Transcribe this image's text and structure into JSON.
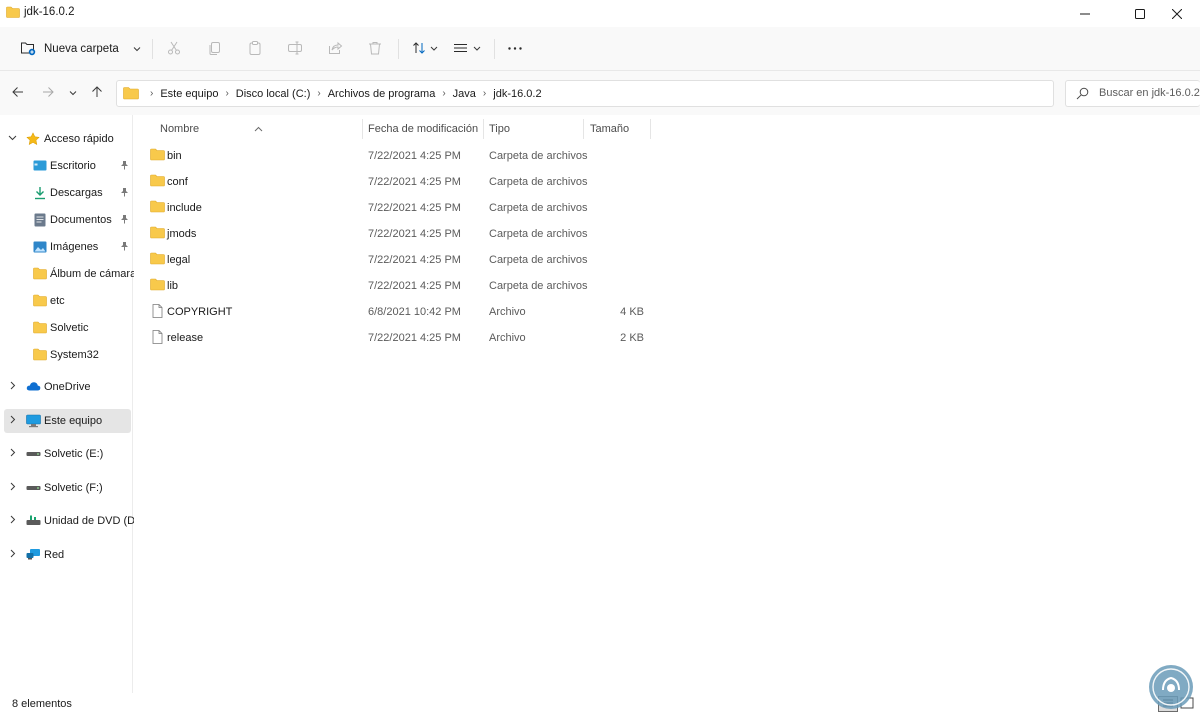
{
  "window": {
    "title": "jdk-16.0.2"
  },
  "command_bar": {
    "new_folder_label": "Nueva carpeta"
  },
  "address": {
    "crumbs": [
      "Este equipo",
      "Disco local (C:)",
      "Archivos de programa",
      "Java",
      "jdk-16.0.2"
    ],
    "search_placeholder": "Buscar en jdk-16.0.2"
  },
  "sidebar": {
    "quick_access": "Acceso rápido",
    "pinned": [
      {
        "label": "Escritorio",
        "icon": "desktop-icon",
        "pinned": true
      },
      {
        "label": "Descargas",
        "icon": "download-icon",
        "pinned": true
      },
      {
        "label": "Documentos",
        "icon": "document-icon",
        "pinned": true
      },
      {
        "label": "Imágenes",
        "icon": "image-icon",
        "pinned": true
      },
      {
        "label": "Álbum de cámara",
        "icon": "folder-icon",
        "pinned": false
      },
      {
        "label": "etc",
        "icon": "folder-icon",
        "pinned": false
      },
      {
        "label": "Solvetic",
        "icon": "folder-icon",
        "pinned": false
      },
      {
        "label": "System32",
        "icon": "folder-icon",
        "pinned": false
      }
    ],
    "roots": [
      {
        "label": "OneDrive",
        "icon": "cloud-icon"
      },
      {
        "label": "Este equipo",
        "icon": "computer-icon",
        "selected": true
      },
      {
        "label": "Solvetic (E:)",
        "icon": "drive-icon"
      },
      {
        "label": "Solvetic (F:)",
        "icon": "drive-icon"
      },
      {
        "label": "Unidad de DVD (D:)",
        "icon": "dvd-icon"
      },
      {
        "label": "Red",
        "icon": "network-icon"
      }
    ]
  },
  "columns": {
    "name": "Nombre",
    "date": "Fecha de modificación",
    "type": "Tipo",
    "size": "Tamaño"
  },
  "files": [
    {
      "name": "bin",
      "date": "7/22/2021 4:25 PM",
      "type": "Carpeta de archivos",
      "size": "",
      "icon": "folder-icon"
    },
    {
      "name": "conf",
      "date": "7/22/2021 4:25 PM",
      "type": "Carpeta de archivos",
      "size": "",
      "icon": "folder-icon"
    },
    {
      "name": "include",
      "date": "7/22/2021 4:25 PM",
      "type": "Carpeta de archivos",
      "size": "",
      "icon": "folder-icon"
    },
    {
      "name": "jmods",
      "date": "7/22/2021 4:25 PM",
      "type": "Carpeta de archivos",
      "size": "",
      "icon": "folder-icon"
    },
    {
      "name": "legal",
      "date": "7/22/2021 4:25 PM",
      "type": "Carpeta de archivos",
      "size": "",
      "icon": "folder-icon"
    },
    {
      "name": "lib",
      "date": "7/22/2021 4:25 PM",
      "type": "Carpeta de archivos",
      "size": "",
      "icon": "folder-icon"
    },
    {
      "name": "COPYRIGHT",
      "date": "6/8/2021 10:42 PM",
      "type": "Archivo",
      "size": "4 KB",
      "icon": "file-icon"
    },
    {
      "name": "release",
      "date": "7/22/2021 4:25 PM",
      "type": "Archivo",
      "size": "2 KB",
      "icon": "file-icon"
    }
  ],
  "status": {
    "item_count": "8 elementos"
  },
  "colors": {
    "folder": "#f8c94b",
    "accent": "#0067c0",
    "selected_bg": "#e5e5e5"
  }
}
